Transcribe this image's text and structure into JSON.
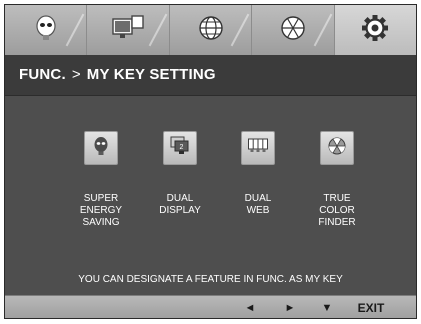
{
  "tabs": [
    {
      "icon": "lightbulb-face-icon",
      "active": false
    },
    {
      "icon": "dual-display-icon",
      "active": false
    },
    {
      "icon": "globe-icon",
      "active": false
    },
    {
      "icon": "color-wheel-icon",
      "active": false
    },
    {
      "icon": "gear-icon",
      "active": true
    }
  ],
  "header": {
    "section": "FUNC.",
    "separator": ">",
    "page": "MY KEY SETTING"
  },
  "items": [
    {
      "icon": "super-energy-saving-icon",
      "lines": [
        "SUPER",
        "ENERGY",
        "SAVING"
      ]
    },
    {
      "icon": "dual-display-icon",
      "lines": [
        "DUAL",
        "DISPLAY"
      ]
    },
    {
      "icon": "dual-web-icon",
      "lines": [
        "DUAL",
        "WEB"
      ]
    },
    {
      "icon": "true-color-finder-icon",
      "lines": [
        "TRUE",
        "COLOR",
        "FINDER"
      ]
    }
  ],
  "hint": "YOU CAN DESIGNATE A FEATURE IN FUNC. AS MY KEY",
  "bottom": {
    "left": "◄",
    "right": "►",
    "down": "▼",
    "exit": "EXIT"
  }
}
